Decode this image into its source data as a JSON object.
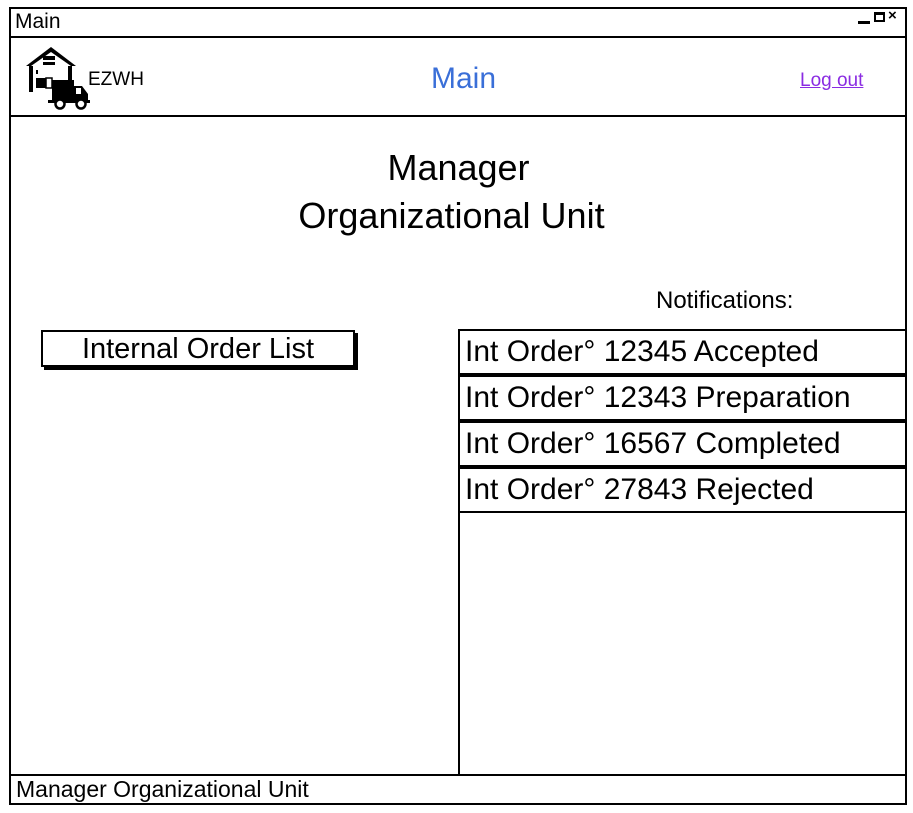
{
  "window": {
    "title": "Main"
  },
  "header": {
    "brand": "EZWH",
    "title": "Main",
    "logout_label": "Log out",
    "logo_icon": "warehouse-truck-icon"
  },
  "main": {
    "heading_line1": "Manager",
    "heading_line2": "Organizational Unit",
    "internal_order_button": "Internal Order List",
    "notifications_label": "Notifications:",
    "notifications": [
      "Int Order° 12345 Accepted",
      "Int Order° 12343 Preparation",
      "Int Order° 16567 Completed",
      "Int Order° 27843 Rejected"
    ]
  },
  "status_bar": {
    "text": "Manager Organizational Unit"
  },
  "colors": {
    "title": "#3a6fd8",
    "link": "#8a2be2",
    "border": "#000000"
  }
}
